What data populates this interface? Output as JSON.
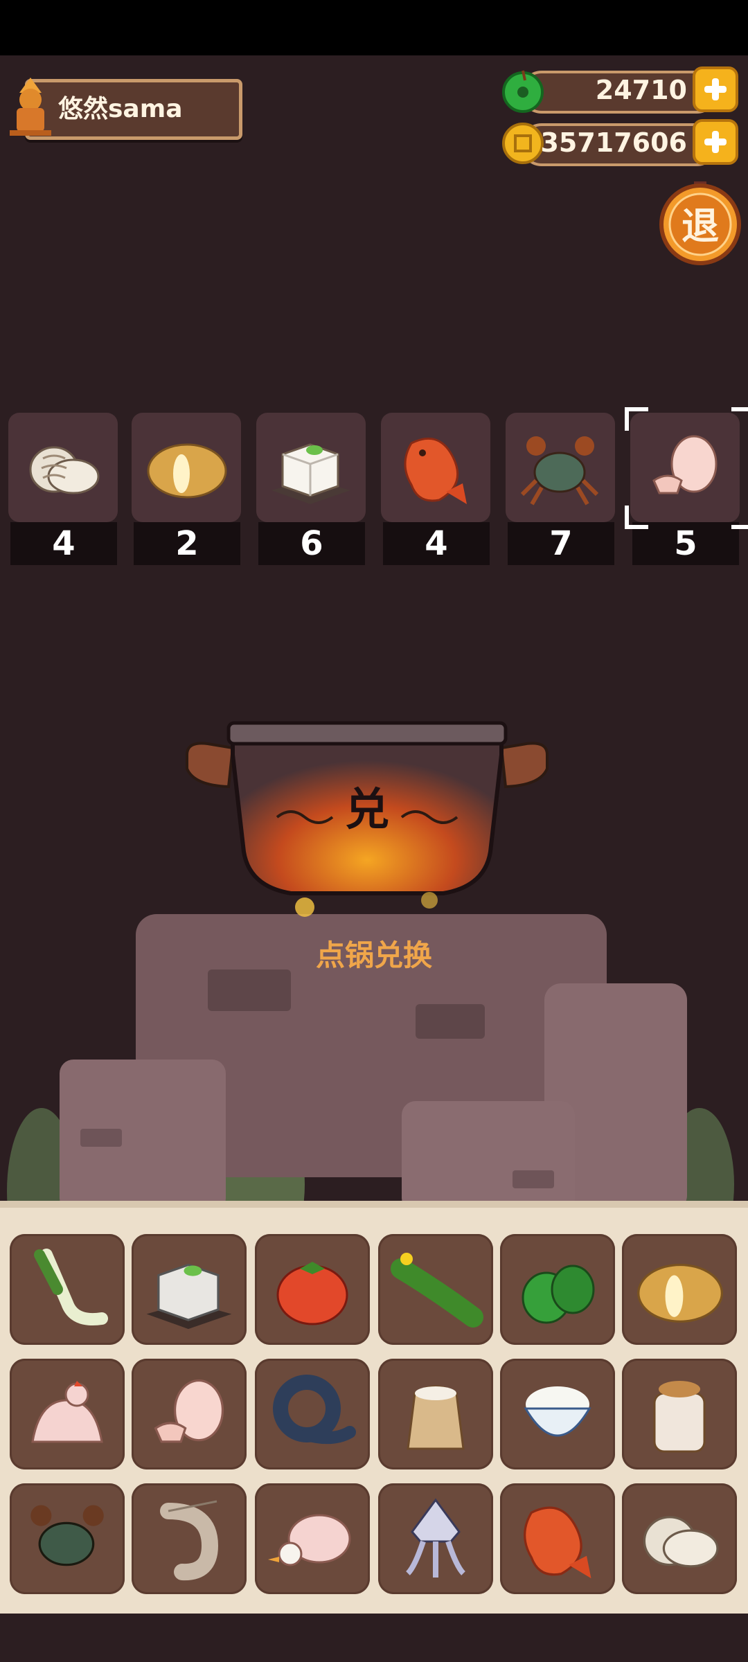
{
  "player": {
    "name": "悠然sama"
  },
  "currency": {
    "jade": {
      "value": "24710",
      "icon": "green-jade-icon"
    },
    "coins": {
      "value": "35717606",
      "icon": "gold-coin-icon"
    }
  },
  "exit_button": {
    "label": "退"
  },
  "required_ingredients": [
    {
      "name": "clam",
      "count": "4"
    },
    {
      "name": "potato",
      "count": "2"
    },
    {
      "name": "tofu",
      "count": "6"
    },
    {
      "name": "fish",
      "count": "4"
    },
    {
      "name": "crab",
      "count": "7"
    },
    {
      "name": "egg",
      "count": "5",
      "selected": true
    }
  ],
  "pot": {
    "character": "兑",
    "label": "点锅兑换"
  },
  "inventory": [
    [
      "leek",
      "tofu",
      "tomato",
      "cucumber",
      "green-pepper",
      "potato"
    ],
    [
      "chicken",
      "egg",
      "eel",
      "flour-sack",
      "rice-bowl",
      "sauce-jar"
    ],
    [
      "crab",
      "shrimp",
      "duck",
      "squid",
      "fish",
      "clam"
    ]
  ]
}
